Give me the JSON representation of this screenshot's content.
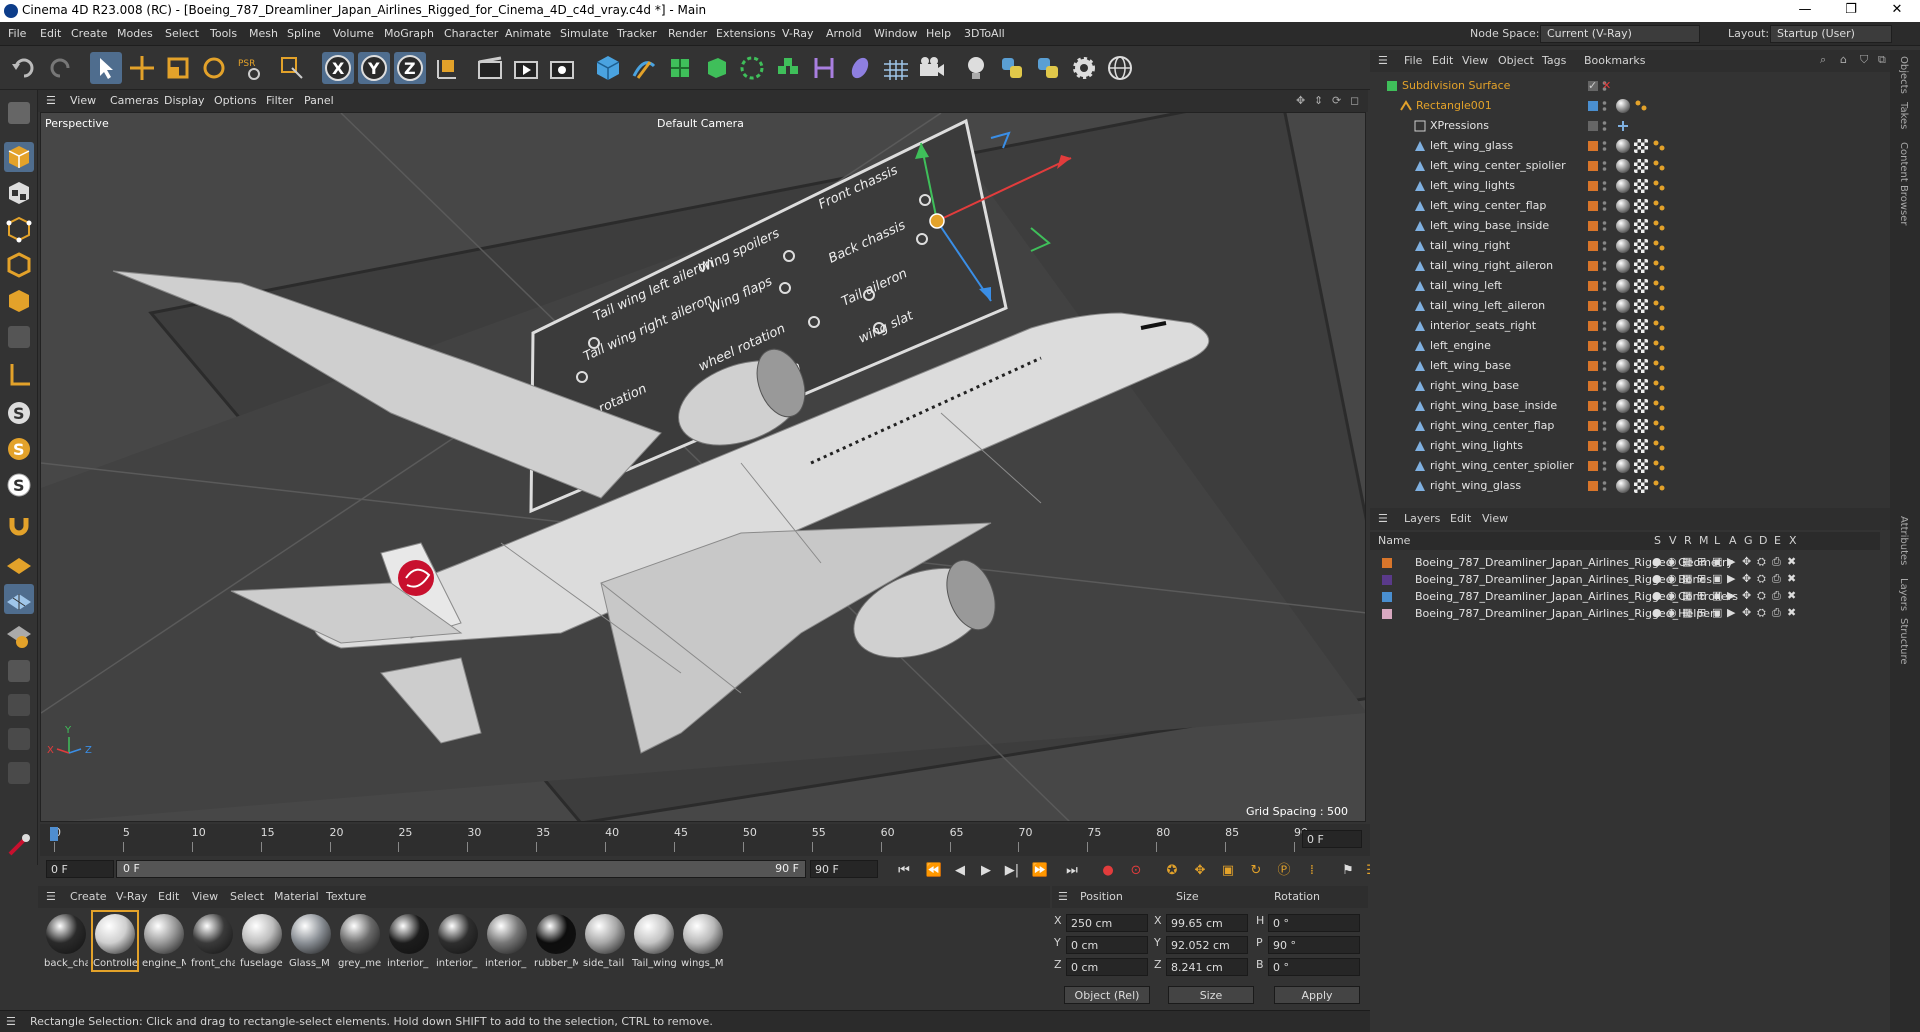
{
  "window": {
    "title": "Cinema 4D R23.008 (RC) - [Boeing_787_Dreamliner_Japan_Airlines_Rigged_for_Cinema_4D_c4d_vray.c4d *] - Main",
    "controls": [
      "—",
      "❐",
      "✕"
    ]
  },
  "menu": [
    "File",
    "Edit",
    "Create",
    "Modes",
    "Select",
    "Tools",
    "Mesh",
    "Spline",
    "Volume",
    "MoGraph",
    "Character",
    "Animate",
    "Simulate",
    "Tracker",
    "Render",
    "Extensions",
    "V-Ray",
    "Arnold",
    "Window",
    "Help",
    "3DToAll"
  ],
  "node_space": {
    "label": "Node Space:",
    "value": "Current (V-Ray)"
  },
  "layout": {
    "label": "Layout:",
    "value": "Startup (User)"
  },
  "viewport": {
    "menu": [
      "View",
      "Cameras",
      "Display",
      "Options",
      "Filter",
      "Panel"
    ],
    "name": "Perspective",
    "camera": "Default Camera",
    "grid_spacing": "Grid Spacing : 500 cm",
    "panel_labels": [
      "Tail wing left aileron",
      "Tail wing right aileron",
      "rotation",
      "Wing spoilers",
      "Wing flaps",
      "wheel rotation",
      "aileron",
      "Front chassis",
      "Back chassis",
      "Tail aileron",
      "wing slat"
    ],
    "axis": {
      "x": "X",
      "y": "Y",
      "z": "Z"
    }
  },
  "timeline": {
    "ticks": [
      "0",
      "5",
      "10",
      "15",
      "20",
      "25",
      "30",
      "35",
      "40",
      "45",
      "50",
      "55",
      "60",
      "65",
      "70",
      "75",
      "80",
      "85",
      "90"
    ],
    "current_frame": "0 F",
    "start": "0 F",
    "range_start": "0 F",
    "range_end": "90 F",
    "end": "90 F"
  },
  "materials": {
    "menu": [
      "Create",
      "V-Ray",
      "Edit",
      "View",
      "Select",
      "Material",
      "Texture"
    ],
    "items": [
      {
        "name": "back_cha",
        "color": "#2a2a2a"
      },
      {
        "name": "Controlle",
        "color": "#cfcfcf"
      },
      {
        "name": "engine_M",
        "color": "#9a9a9a"
      },
      {
        "name": "front_cha",
        "color": "#3a3a3a"
      },
      {
        "name": "fuselage",
        "color": "#bdbdbd"
      },
      {
        "name": "Glass_M",
        "color": "#8a8f95"
      },
      {
        "name": "grey_me",
        "color": "#6a6a6a"
      },
      {
        "name": "interior_",
        "color": "#1c1c1c"
      },
      {
        "name": "interior_",
        "color": "#2e2e2e"
      },
      {
        "name": "interior_",
        "color": "#777"
      },
      {
        "name": "rubber_M",
        "color": "#0d0d0d"
      },
      {
        "name": "side_tail",
        "color": "#a8a8a8"
      },
      {
        "name": "Tail_wing",
        "color": "#c4c4c4"
      },
      {
        "name": "wings_M",
        "color": "#b8b8b8"
      }
    ]
  },
  "coords": {
    "headers": [
      "Position",
      "Size",
      "Rotation"
    ],
    "rows": [
      {
        "axis": "X",
        "pos": "250 cm",
        "saxis": "X",
        "size": "99.65 cm",
        "raxis": "H",
        "rot": "0 °"
      },
      {
        "axis": "Y",
        "pos": "0 cm",
        "saxis": "Y",
        "size": "92.052 cm",
        "raxis": "P",
        "rot": "90 °"
      },
      {
        "axis": "Z",
        "pos": "0 cm",
        "saxis": "Z",
        "size": "8.241 cm",
        "raxis": "B",
        "rot": "0 °"
      }
    ],
    "mode": "Object (Rel)",
    "size_mode": "Size",
    "apply": "Apply"
  },
  "status": "Rectangle Selection: Click and drag to rectangle-select elements. Hold down SHIFT to add to the selection, CTRL to remove.",
  "objects": {
    "menu": [
      "File",
      "Edit",
      "View",
      "Object",
      "Tags",
      "Bookmarks"
    ],
    "items": [
      {
        "name": "Subdivision Surface",
        "color": "#e3a22a",
        "indent": 0
      },
      {
        "name": "Rectangle001",
        "color": "#e3a22a",
        "indent": 1
      },
      {
        "name": "XPressions",
        "color": "#e4e4e4",
        "indent": 2
      },
      {
        "name": "left_wing_glass",
        "color": "#e4e4e4",
        "indent": 2
      },
      {
        "name": "left_wing_center_spiolier",
        "color": "#e4e4e4",
        "indent": 2
      },
      {
        "name": "left_wing_lights",
        "color": "#e4e4e4",
        "indent": 2
      },
      {
        "name": "left_wing_center_flap",
        "color": "#e4e4e4",
        "indent": 2
      },
      {
        "name": "left_wing_base_inside",
        "color": "#e4e4e4",
        "indent": 2
      },
      {
        "name": "tail_wing_right",
        "color": "#e4e4e4",
        "indent": 2
      },
      {
        "name": "tail_wing_right_aileron",
        "color": "#e4e4e4",
        "indent": 2
      },
      {
        "name": "tail_wing_left",
        "color": "#e4e4e4",
        "indent": 2
      },
      {
        "name": "tail_wing_left_aileron",
        "color": "#e4e4e4",
        "indent": 2
      },
      {
        "name": "interior_seats_right",
        "color": "#e4e4e4",
        "indent": 2
      },
      {
        "name": "left_engine",
        "color": "#e4e4e4",
        "indent": 2
      },
      {
        "name": "left_wing_base",
        "color": "#e4e4e4",
        "indent": 2
      },
      {
        "name": "right_wing_base",
        "color": "#e4e4e4",
        "indent": 2
      },
      {
        "name": "right_wing_base_inside",
        "color": "#e4e4e4",
        "indent": 2
      },
      {
        "name": "right_wing_center_flap",
        "color": "#e4e4e4",
        "indent": 2
      },
      {
        "name": "right_wing_lights",
        "color": "#e4e4e4",
        "indent": 2
      },
      {
        "name": "right_wing_center_spiolier",
        "color": "#e4e4e4",
        "indent": 2
      },
      {
        "name": "right_wing_glass",
        "color": "#e4e4e4",
        "indent": 2
      }
    ]
  },
  "layers": {
    "menu": [
      "Layers",
      "Edit",
      "View"
    ],
    "head_name": "Name",
    "head_cols": [
      "S",
      "V",
      "R",
      "M",
      "L",
      "A",
      "G",
      "D",
      "E",
      "X"
    ],
    "items": [
      {
        "name": "Boeing_787_Dreamliner_Japan_Airlines_Rigged_Geometry",
        "color": "#d9762b"
      },
      {
        "name": "Boeing_787_Dreamliner_Japan_Airlines_Rigged_Bones",
        "color": "#5a3a8a"
      },
      {
        "name": "Boeing_787_Dreamliner_Japan_Airlines_Rigged_Controllers",
        "color": "#4a8fd0"
      },
      {
        "name": "Boeing_787_Dreamliner_Japan_Airlines_Rigged_Helpers",
        "color": "#d8a8c0"
      }
    ]
  },
  "side_tabs": [
    "Objects",
    "Takes",
    "Content Browser",
    "Attributes",
    "Layers",
    "Structure"
  ],
  "colors": {
    "accent": "#4f6d8e",
    "orange": "#e3a22a",
    "jal_red": "#c8102e"
  }
}
